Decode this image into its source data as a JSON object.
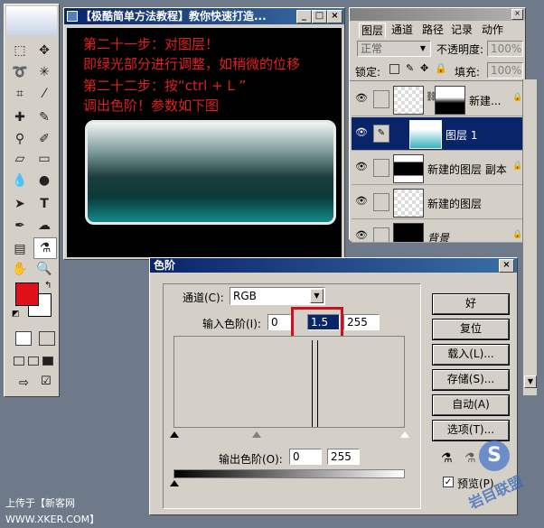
{
  "document": {
    "title": "【极酷简单方法教程】教你快速打造...",
    "lines": [
      "第二十一步：对图层！",
      "即绿光部分进行调整，如稍微的位移",
      "第二十二步：按“ctrl + L ”",
      "调出色阶！参数如下图"
    ]
  },
  "layers_panel": {
    "tabs": [
      "图层",
      "通道",
      "路径",
      "记录",
      "动作"
    ],
    "blend_mode": "正常",
    "opacity_label": "不透明度:",
    "opacity_value": "100%",
    "lock_label": "锁定:",
    "fill_label": "填充:",
    "fill_value": "100%",
    "layers": [
      {
        "name": "新建...",
        "selected": false
      },
      {
        "name": "图层 1",
        "selected": true
      },
      {
        "name": "新建的图层 副本",
        "selected": false
      },
      {
        "name": "新建的图层",
        "selected": false
      },
      {
        "name": "背景",
        "selected": false
      }
    ]
  },
  "levels_dialog": {
    "title": "色阶",
    "channel_label": "通道(C):",
    "channel_value": "RGB",
    "input_label": "输入色阶(I):",
    "input_black": "0",
    "input_gamma": "1.5",
    "input_white": "255",
    "output_label": "输出色阶(O):",
    "output_black": "0",
    "output_white": "255",
    "buttons": {
      "ok": "好",
      "reset": "复位",
      "load": "载入(L)...",
      "save": "存储(S)...",
      "auto": "自动(A)",
      "options": "选项(T)..."
    },
    "preview_label": "预览(P)"
  },
  "footer": {
    "upload_text": "上传于【新客网 WWW.XKER.COM】",
    "logo_text": "岩目联盟"
  },
  "colors": {
    "foreground": "#e0101a",
    "background": "#ffffff",
    "highlight_box": "#cc1020"
  }
}
